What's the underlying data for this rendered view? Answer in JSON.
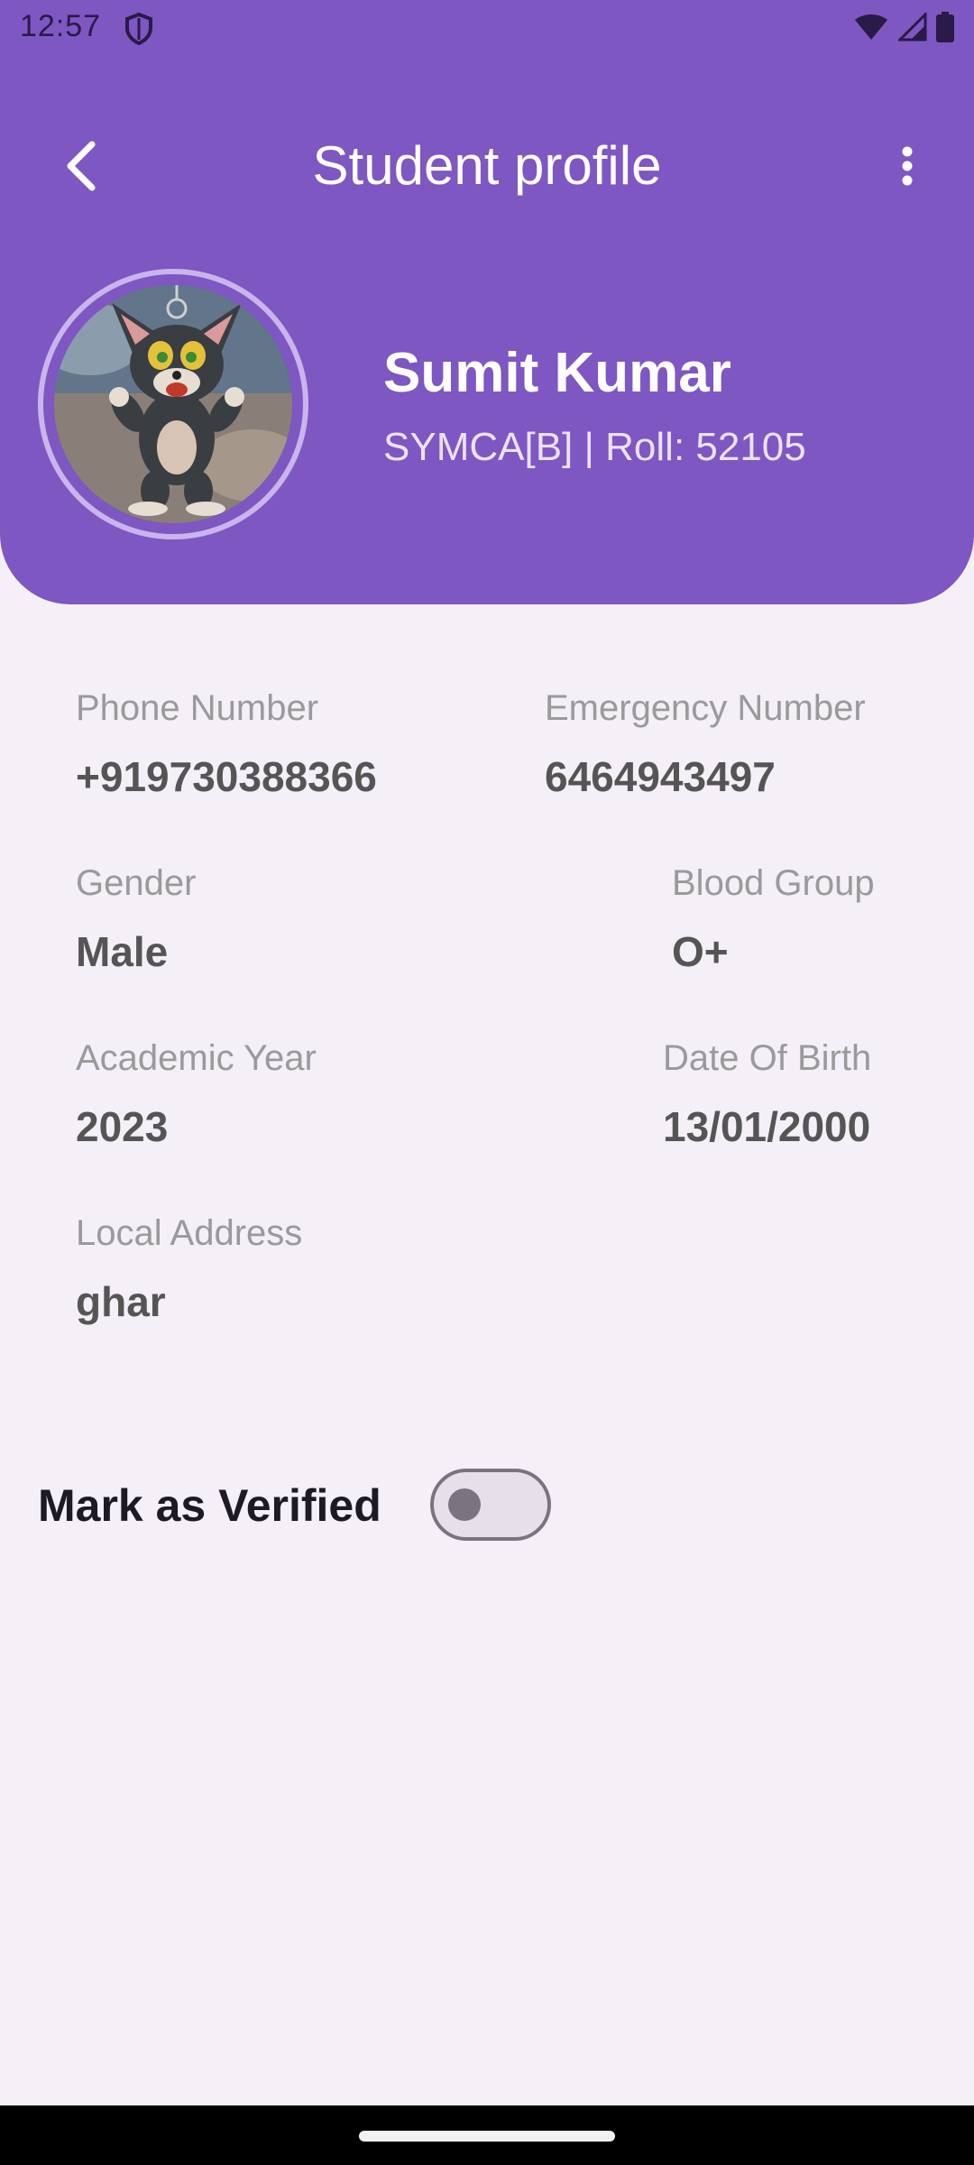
{
  "status_bar": {
    "time": "12:57",
    "icons": [
      "shield-icon",
      "wifi-icon",
      "signal-icon",
      "battery-icon"
    ]
  },
  "app_bar": {
    "title": "Student profile",
    "back_icon": "chevron-left-icon",
    "menu_icon": "more-vertical-icon"
  },
  "profile": {
    "name": "Sumit Kumar",
    "subtitle": "SYMCA[B] | Roll: 52105",
    "avatar": "cartoon-cat-avatar"
  },
  "details": {
    "phone": {
      "label": "Phone Number",
      "value": "+919730388366"
    },
    "emergency": {
      "label": "Emergency Number",
      "value": "6464943497"
    },
    "gender": {
      "label": "Gender",
      "value": "Male"
    },
    "blood_group": {
      "label": "Blood Group",
      "value": "O+"
    },
    "academic_year": {
      "label": "Academic Year",
      "value": "2023"
    },
    "dob": {
      "label": "Date Of Birth",
      "value": "13/01/2000"
    },
    "address": {
      "label": "Local Address",
      "value": "ghar"
    }
  },
  "verification": {
    "label": "Mark as Verified",
    "checked": false
  },
  "colors": {
    "primary": "#7e57c2",
    "background": "#f5eff7",
    "label_gray": "#9a9a9a",
    "value_gray": "#555555"
  }
}
